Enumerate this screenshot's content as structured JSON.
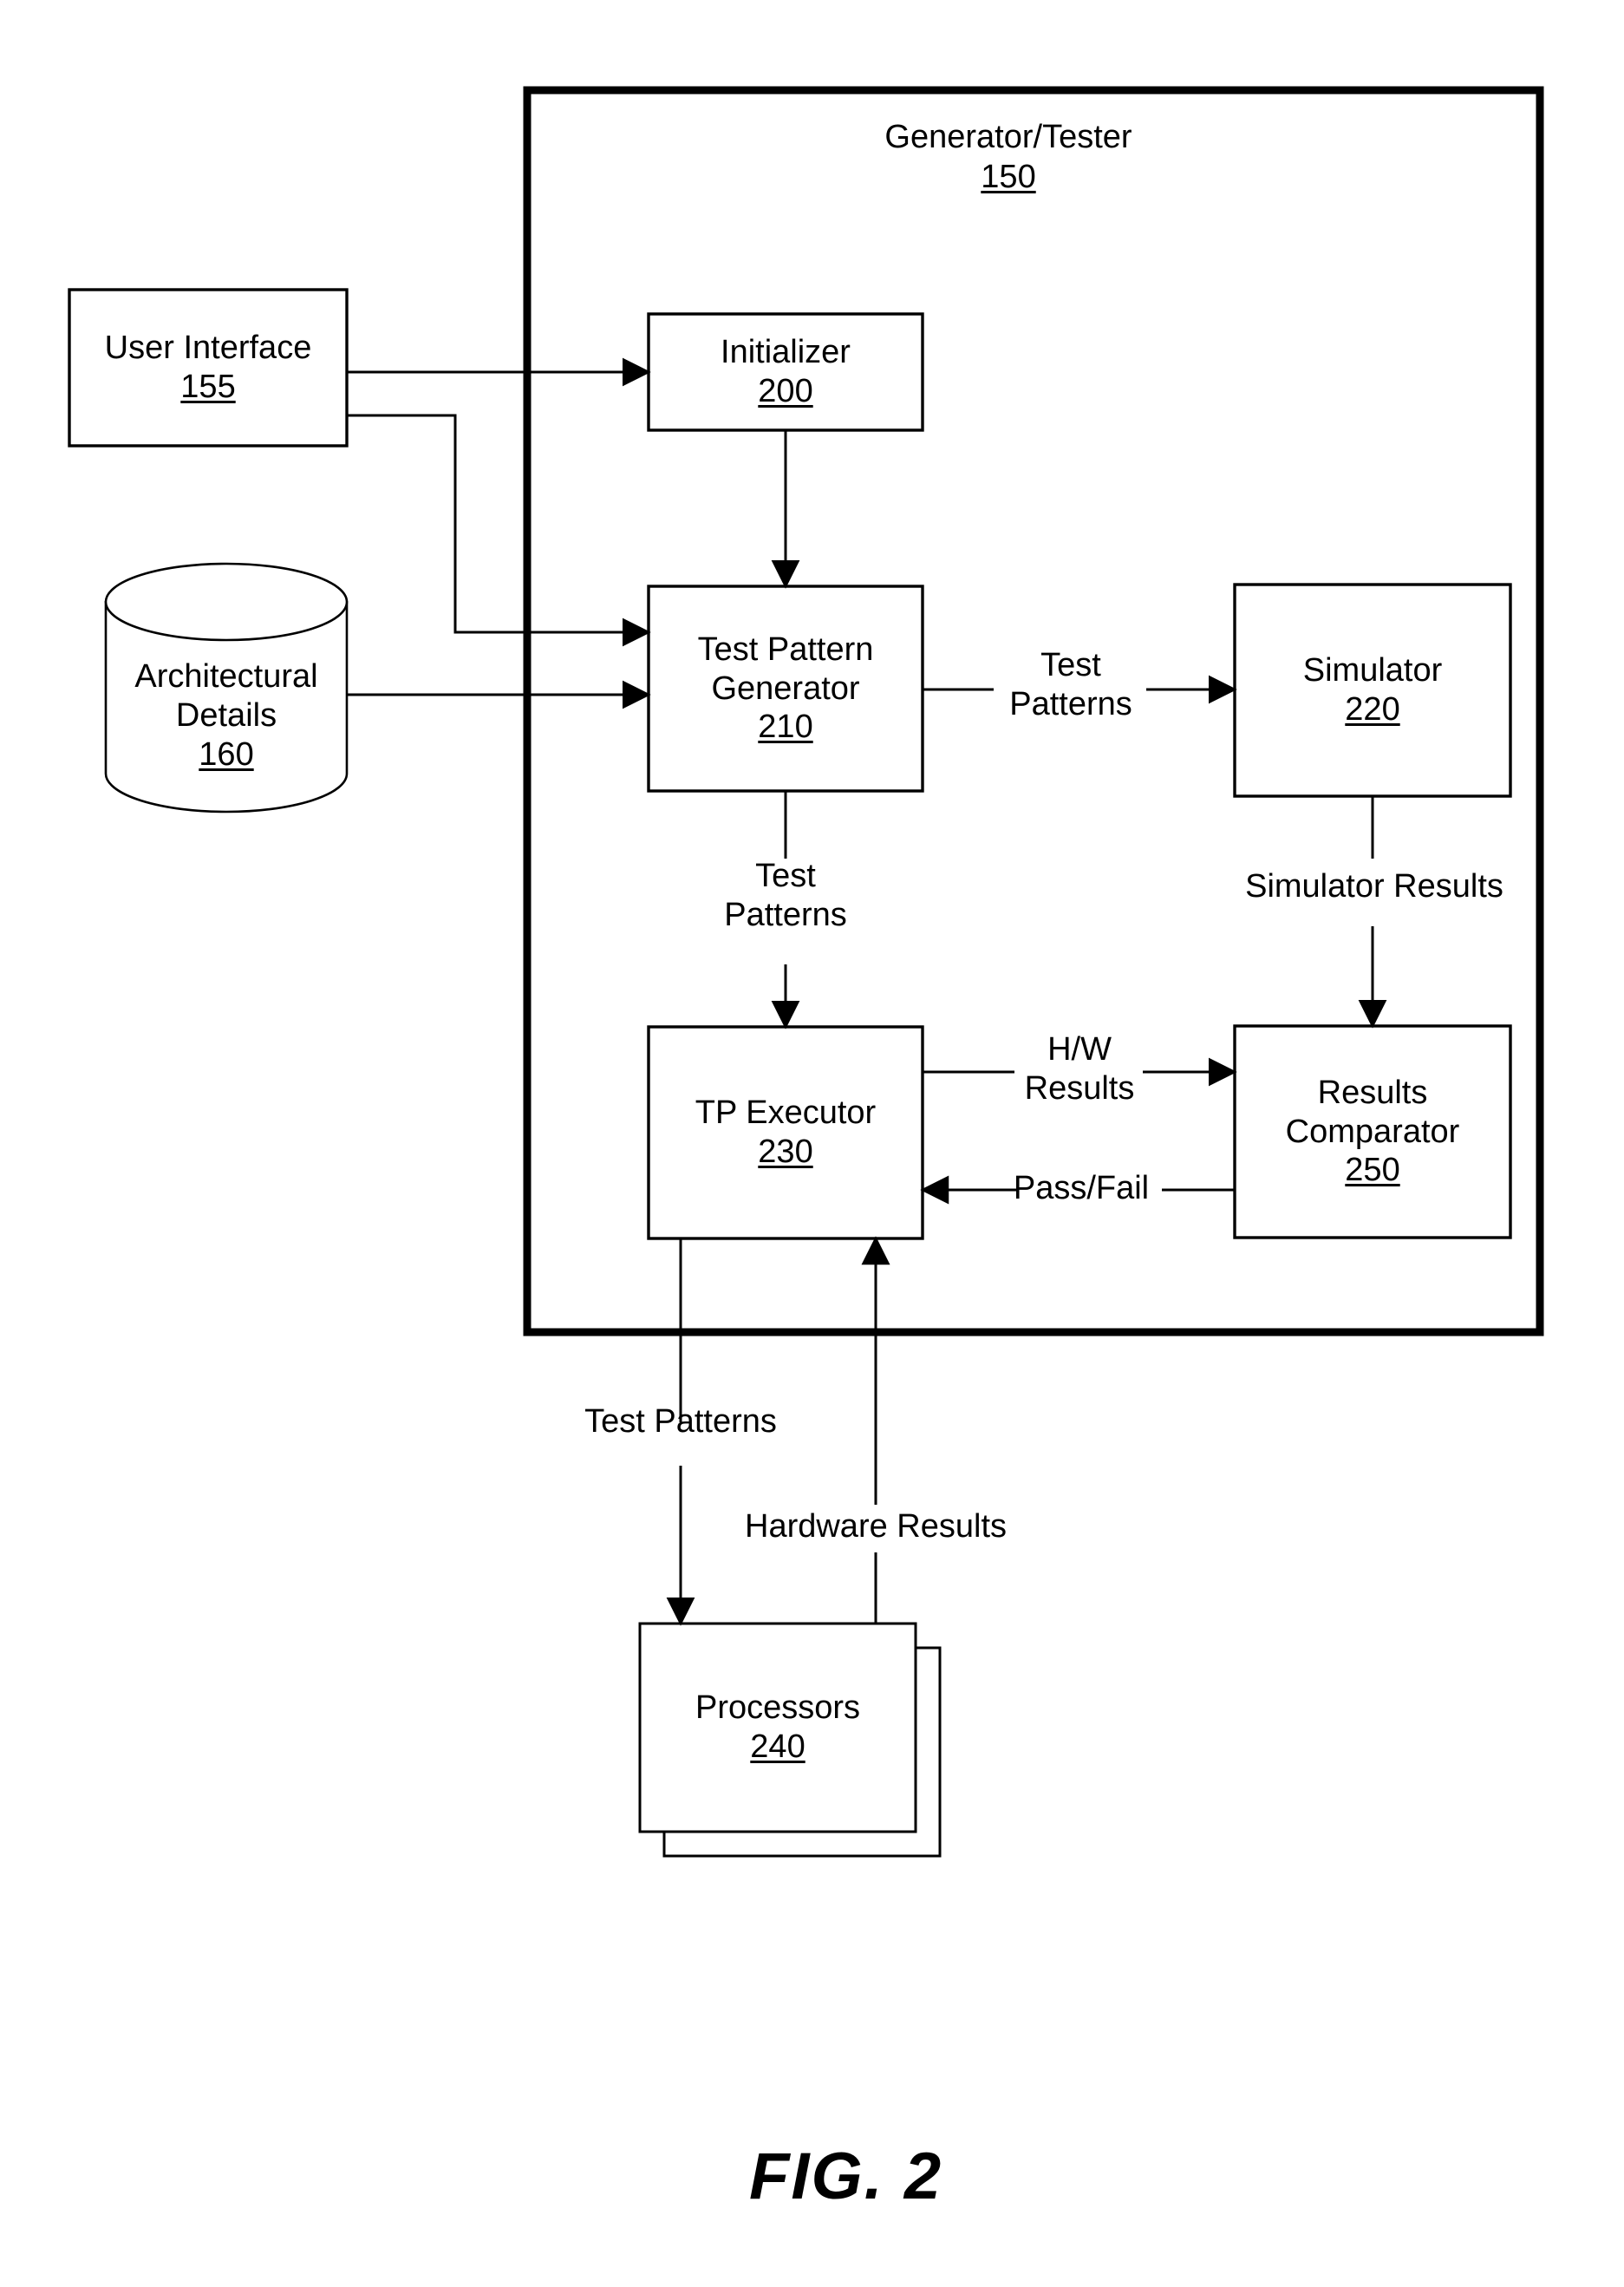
{
  "figure": {
    "caption": "FIG. 2",
    "group": {
      "title": "Generator/Tester",
      "ref": "150"
    }
  },
  "nodes": {
    "user_interface": {
      "title": "User Interface",
      "ref": "155",
      "shape": "rectangle"
    },
    "architectural_details": {
      "title_line1": "Architectural",
      "title_line2": "Details",
      "ref": "160",
      "shape": "cylinder"
    },
    "initializer": {
      "title": "Initializer",
      "ref": "200",
      "shape": "rectangle"
    },
    "test_pattern_generator": {
      "title_line1": "Test Pattern",
      "title_line2": "Generator",
      "ref": "210",
      "shape": "rectangle"
    },
    "simulator": {
      "title": "Simulator",
      "ref": "220",
      "shape": "rectangle"
    },
    "tp_executor": {
      "title": "TP Executor",
      "ref": "230",
      "shape": "rectangle"
    },
    "processors": {
      "title": "Processors",
      "ref": "240",
      "shape": "stacked-rectangle"
    },
    "results_comparator": {
      "title_line1": "Results",
      "title_line2": "Comparator",
      "ref": "250",
      "shape": "rectangle"
    }
  },
  "edge_labels": {
    "tpg_to_simulator": "Test\nPatterns",
    "tpg_to_executor": "Test\nPatterns",
    "simulator_to_comparator": "Simulator Results",
    "executor_to_comparator": "H/W\nResults",
    "comparator_to_executor": "Pass/Fail",
    "executor_to_processors": "Test Patterns",
    "processors_to_executor": "Hardware Results"
  },
  "edges": [
    {
      "from": "user_interface",
      "to": "initializer",
      "label": ""
    },
    {
      "from": "user_interface",
      "to": "test_pattern_generator",
      "label": ""
    },
    {
      "from": "architectural_details",
      "to": "test_pattern_generator",
      "label": ""
    },
    {
      "from": "initializer",
      "to": "test_pattern_generator",
      "label": ""
    },
    {
      "from": "test_pattern_generator",
      "to": "simulator",
      "label": "Test Patterns"
    },
    {
      "from": "test_pattern_generator",
      "to": "tp_executor",
      "label": "Test Patterns"
    },
    {
      "from": "simulator",
      "to": "results_comparator",
      "label": "Simulator Results"
    },
    {
      "from": "tp_executor",
      "to": "results_comparator",
      "label": "H/W Results"
    },
    {
      "from": "results_comparator",
      "to": "tp_executor",
      "label": "Pass/Fail"
    },
    {
      "from": "tp_executor",
      "to": "processors",
      "label": "Test Patterns"
    },
    {
      "from": "processors",
      "to": "tp_executor",
      "label": "Hardware Results"
    }
  ],
  "colors": {
    "stroke": "#000000",
    "background": "#ffffff",
    "group_stroke": "#000000"
  }
}
